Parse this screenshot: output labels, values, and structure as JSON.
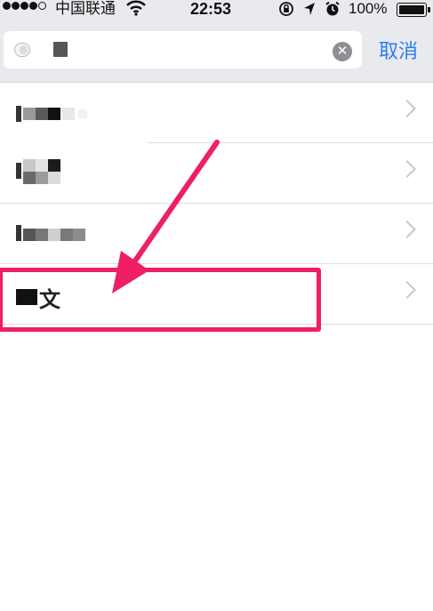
{
  "status_bar": {
    "carrier": "中国联通",
    "time": "22:53",
    "battery_percent": "100%",
    "icons": [
      "signal-dots",
      "wifi-icon",
      "orientation-lock-icon",
      "location-arrow-icon",
      "alarm-icon",
      "battery-icon"
    ]
  },
  "search": {
    "value": "",
    "clear_icon": "clear-icon",
    "cancel_label": "取消"
  },
  "results": [
    {
      "label": ""
    },
    {
      "label": ""
    },
    {
      "label": ""
    },
    {
      "label": "文"
    }
  ],
  "annotation": {
    "color": "#ee1f63"
  }
}
